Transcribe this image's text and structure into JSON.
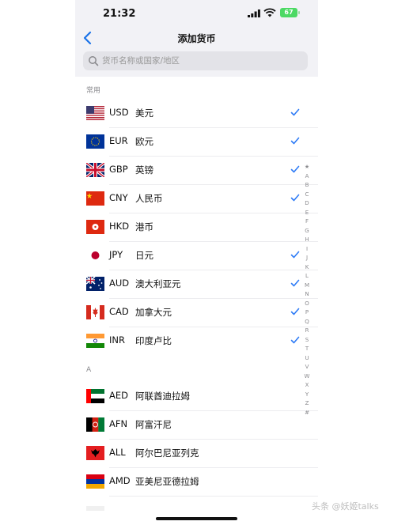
{
  "status": {
    "time": "21:32",
    "battery": "67"
  },
  "nav": {
    "title": "添加货币"
  },
  "search": {
    "placeholder": "货币名称或国家/地区"
  },
  "sections": {
    "common": "常用",
    "a": "A"
  },
  "common_currencies": [
    {
      "code": "USD",
      "name": "美元",
      "checked": true,
      "flag": "us-flag"
    },
    {
      "code": "EUR",
      "name": "欧元",
      "checked": true,
      "flag": "eu-flag"
    },
    {
      "code": "GBP",
      "name": "英镑",
      "checked": true,
      "flag": "uk-flag"
    },
    {
      "code": "CNY",
      "name": "人民币",
      "checked": true,
      "flag": "cn-flag"
    },
    {
      "code": "HKD",
      "name": "港币",
      "checked": false,
      "flag": "hk-flag"
    },
    {
      "code": "JPY",
      "name": "日元",
      "checked": true,
      "flag": "jp-flag"
    },
    {
      "code": "AUD",
      "name": "澳大利亚元",
      "checked": true,
      "flag": "au-flag"
    },
    {
      "code": "CAD",
      "name": "加拿大元",
      "checked": true,
      "flag": "ca-flag"
    },
    {
      "code": "INR",
      "name": "印度卢比",
      "checked": true,
      "flag": "in-flag"
    }
  ],
  "a_currencies": [
    {
      "code": "AED",
      "name": "阿联酋迪拉姆",
      "checked": false,
      "flag": "ae-flag"
    },
    {
      "code": "AFN",
      "name": "阿富汗尼",
      "checked": false,
      "flag": "af-flag"
    },
    {
      "code": "ALL",
      "name": "阿尔巴尼亚列克",
      "checked": false,
      "flag": "al-flag"
    },
    {
      "code": "AMD",
      "name": "亚美尼亚德拉姆",
      "checked": false,
      "flag": "am-flag"
    }
  ],
  "index_letters": [
    "★",
    "A",
    "B",
    "C",
    "D",
    "E",
    "F",
    "G",
    "H",
    "I",
    "J",
    "K",
    "L",
    "M",
    "N",
    "O",
    "P",
    "Q",
    "R",
    "S",
    "T",
    "U",
    "V",
    "W",
    "X",
    "Y",
    "Z",
    "#"
  ],
  "colors": {
    "accent": "#1a73e8",
    "checkmark": "#2f7cf6",
    "battery": "#4cd964"
  },
  "watermark": "头条 @妖姬talks"
}
